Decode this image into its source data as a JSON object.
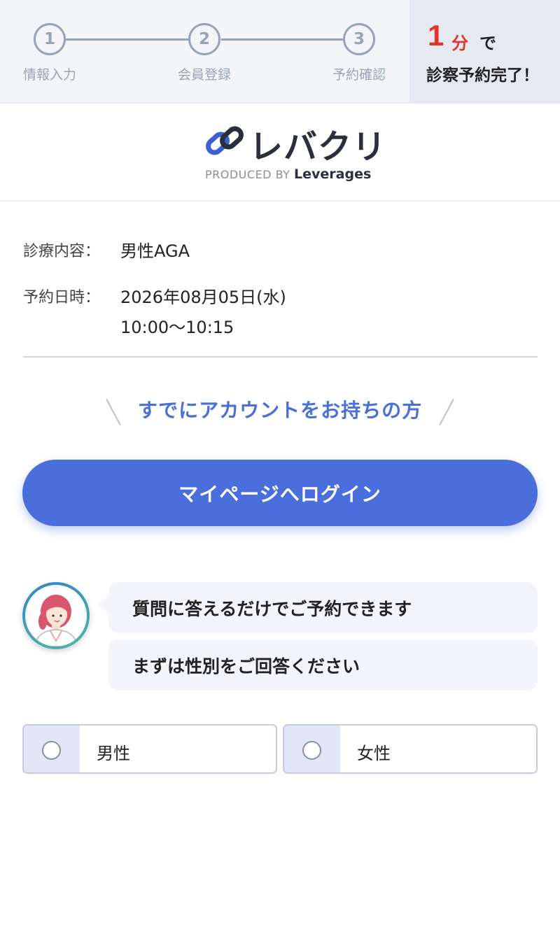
{
  "progress": {
    "steps": [
      {
        "number": "1",
        "label": "情報入力"
      },
      {
        "number": "2",
        "label": "会員登録"
      },
      {
        "number": "3",
        "label": "予約確認"
      }
    ],
    "promo": {
      "big_number": "1",
      "unit": "分",
      "particle": "で",
      "line2": "診察予約完了！"
    }
  },
  "brand": {
    "logo_icon": "chain-link-icon",
    "name": "レバクリ",
    "produced_by": "PRODUCED BY",
    "company": "Leverages"
  },
  "summary": {
    "treatment_label": "診療内容：",
    "treatment_value": "男性AGA",
    "datetime_label": "予約日時：",
    "date_value": "2026年08月05日(水)",
    "time_value": "10:00〜10:15"
  },
  "account": {
    "heading": "すでにアカウントをお持ちの方",
    "login_button": "マイページへログイン"
  },
  "chat": {
    "avatar_icon": "nurse-avatar-icon",
    "messages": [
      "質問に答えるだけでご予約できます",
      "まずは性別をご回答ください"
    ]
  },
  "gender": {
    "options": [
      {
        "label": "男性",
        "selected": false
      },
      {
        "label": "女性",
        "selected": false
      }
    ]
  },
  "colors": {
    "accent": "#4a6fdc",
    "promo_red": "#e0362c",
    "step_gray": "#98a2bb"
  }
}
